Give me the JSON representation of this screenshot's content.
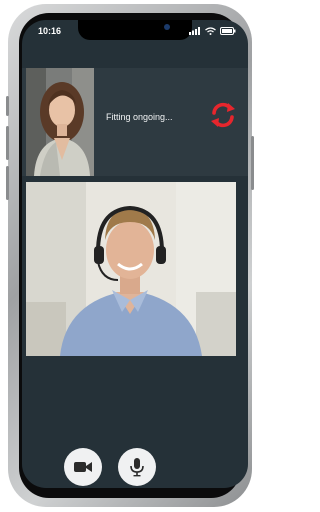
{
  "statusbar": {
    "time": "10:16"
  },
  "call": {
    "status_text": "Fitting ongoing..."
  },
  "colors": {
    "accent": "#e6262d",
    "panel": "#2e3a41",
    "screen_bg": "#253138"
  },
  "icons": {
    "refresh": "refresh-icon",
    "camera": "video-camera-icon",
    "mic": "microphone-icon"
  }
}
